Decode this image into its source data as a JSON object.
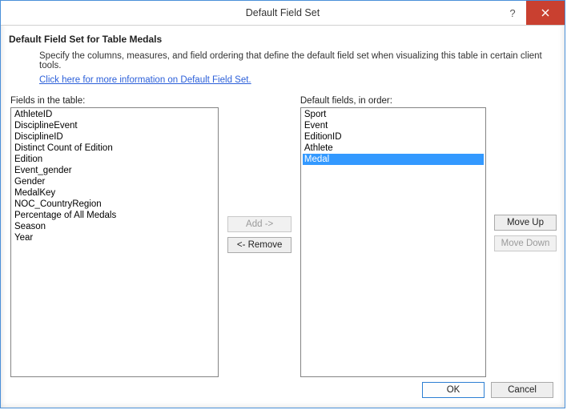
{
  "title": "Default Field Set",
  "header": "Default Field Set for Table Medals",
  "description": "Specify the columns, measures, and field ordering that define the default field set when visualizing this table in certain client tools.",
  "link_text": "Click here for more information on Default Field Set.",
  "labels": {
    "left": "Fields in the table:",
    "right": "Default fields, in order:"
  },
  "buttons": {
    "add": "Add ->",
    "remove": "<- Remove",
    "move_up": "Move Up",
    "move_down": "Move Down",
    "ok": "OK",
    "cancel": "Cancel"
  },
  "left_list": [
    "AthleteID",
    "DisciplineEvent",
    "DisciplineID",
    "Distinct Count of Edition",
    "Edition",
    "Event_gender",
    "Gender",
    "MedalKey",
    "NOC_CountryRegion",
    "Percentage of All Medals",
    "Season",
    "Year"
  ],
  "right_list": [
    {
      "label": "Sport",
      "selected": false
    },
    {
      "label": "Event",
      "selected": false
    },
    {
      "label": "EditionID",
      "selected": false
    },
    {
      "label": "Athlete",
      "selected": false
    },
    {
      "label": "Medal",
      "selected": true
    }
  ]
}
